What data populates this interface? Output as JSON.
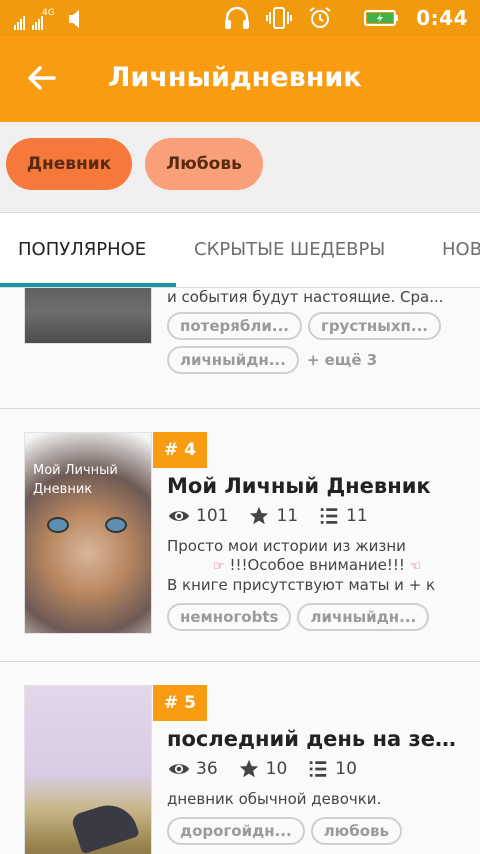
{
  "status_bar": {
    "network": "4G",
    "time": "0:44"
  },
  "app_bar": {
    "title": "Личныйдневник"
  },
  "chips": [
    {
      "label": "Дневник"
    },
    {
      "label": "Любовь"
    }
  ],
  "tabs": [
    {
      "label": "ПОПУЛЯРНОЕ",
      "active": true
    },
    {
      "label": "СКРЫТЫЕ ШЕДЕВРЫ"
    },
    {
      "label": "НОВ"
    }
  ],
  "stories": [
    {
      "description": "и события будут настоящие. Сра...",
      "tags": [
        "потерябли...",
        "грустныхп...",
        "личныйдн..."
      ],
      "more": "+ ещё 3"
    },
    {
      "rank": "# 4",
      "cover_text": "Мой Личный Дневник",
      "title": "Мой Личный Дневник",
      "views": "101",
      "votes": "11",
      "parts": "11",
      "description_lines": [
        "Просто мои истории из жизни",
        "!!!Особое внимание!!!",
        "В книге присутствуют маты и + к"
      ],
      "tags": [
        "немногоbts",
        "личныйдн..."
      ]
    },
    {
      "rank": "# 5",
      "title": "последний день на зем...",
      "views": "36",
      "votes": "10",
      "parts": "10",
      "description": "дневник обычной девочки.",
      "tags": [
        "дорогойдн...",
        "любовь"
      ]
    }
  ],
  "colors": {
    "status_bar": "#f29a0e",
    "app_bar": "#f99c12",
    "chip_primary": "#f4793b",
    "chip_secondary": "#f9a07a",
    "tab_indicator": "#1a96a6",
    "rank_badge": "#f99c12"
  },
  "icons": [
    "signal-icon",
    "volume-icon",
    "headphones-icon",
    "vibrate-icon",
    "alarm-icon",
    "battery-charging-icon",
    "back-arrow-icon",
    "eye-icon",
    "star-icon",
    "list-icon"
  ]
}
